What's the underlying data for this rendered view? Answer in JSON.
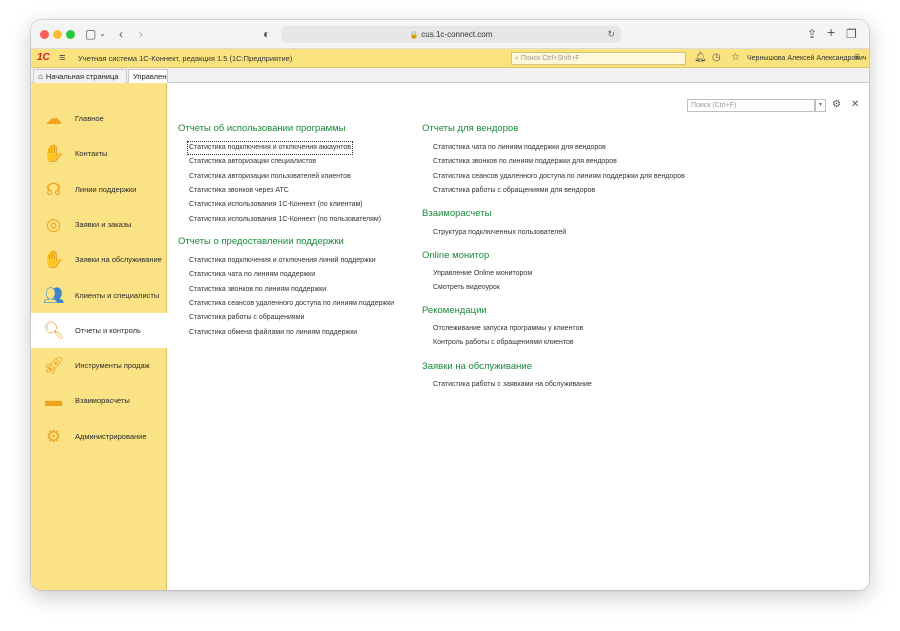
{
  "browser": {
    "url": "cus.1c-connect.com"
  },
  "app": {
    "logo": "1С",
    "title": "Учетная система 1С-Коннект, редакция 1.5  (1С:Предприятие)",
    "search_placeholder": "Поиск Ctrl+Shift+F",
    "user": "Чернышова Алексей Александрович"
  },
  "tabs": [
    {
      "label": "Начальная страница"
    },
    {
      "label": "Управление отчетами"
    }
  ],
  "sidebar": {
    "items": [
      {
        "label": "Главное",
        "icon": "cloud-icon",
        "color": "#f0a21c"
      },
      {
        "label": "Контакты",
        "icon": "handshake-icon",
        "color": "#f0a21c"
      },
      {
        "label": "Линии поддержки",
        "icon": "headset-icon",
        "color": "#f0a21c"
      },
      {
        "label": "Заявки и заказы",
        "icon": "target-icon",
        "color": "#f0a21c"
      },
      {
        "label": "Заявки на обслуживание",
        "icon": "hand-coin-icon",
        "color": "#f0a21c"
      },
      {
        "label": "Клиенты и специалисты",
        "icon": "people-icon",
        "color": "#3b86c9"
      },
      {
        "label": "Отчеты и контроль",
        "icon": "magnifier-chart-icon",
        "color": "#f0a21c"
      },
      {
        "label": "Инструменты продаж",
        "icon": "rocket-icon",
        "color": "#f0a21c"
      },
      {
        "label": "Взаиморасчеты",
        "icon": "wallet-icon",
        "color": "#f0a21c"
      },
      {
        "label": "Администрирование",
        "icon": "gear-icon",
        "color": "#f0a21c"
      }
    ],
    "active_index": 6
  },
  "main": {
    "search_placeholder": "Поиск (Ctrl+F)",
    "left_sections": [
      {
        "title": "Отчеты об использовании программы",
        "links": [
          "Статистика подключения и отключения аккаунтов",
          "Статистика авторизации специалистов",
          "Статистика авторизации пользователей клиентов",
          "Статистика звонков через АТС",
          "Статистика использования 1С-Коннект (по клиентам)",
          "Статистика использования 1С-Коннект (по пользователям)"
        ]
      },
      {
        "title": "Отчеты о предоставлении поддержки",
        "links": [
          "Статистика подключения и отключения линий поддержки",
          "Статистика чата по линиям поддержки",
          "Статистика звонков по линиям поддержки",
          "Статистика сеансов удаленного доступа по линиям поддержки",
          "Статистика работы с обращениями",
          "Статистика обмена файлами по линиям поддержки"
        ]
      }
    ],
    "right_sections": [
      {
        "title": "Отчеты для вендоров",
        "links": [
          "Статистика чата по линиям поддержки для вендоров",
          "Статистика звонков по линиям поддержки для вендоров",
          "Статистика сеансов удаленного доступа по линиям поддержки для вендоров",
          "Статистика работы с обращениями для вендоров"
        ]
      },
      {
        "title": "Взаиморасчеты",
        "links": [
          "Структура подключенных пользователей"
        ]
      },
      {
        "title": "Online монитор",
        "links": [
          "Управление Online монитором",
          "Смотреть видеоурок"
        ]
      },
      {
        "title": "Рекомендации",
        "links": [
          "Отслеживание запуска программы у клиентов",
          "Контроль работы с обращениями клиентов"
        ]
      },
      {
        "title": "Заявки на обслуживание",
        "links": [
          "Статистика работы с заявками на обслуживание"
        ]
      }
    ]
  }
}
